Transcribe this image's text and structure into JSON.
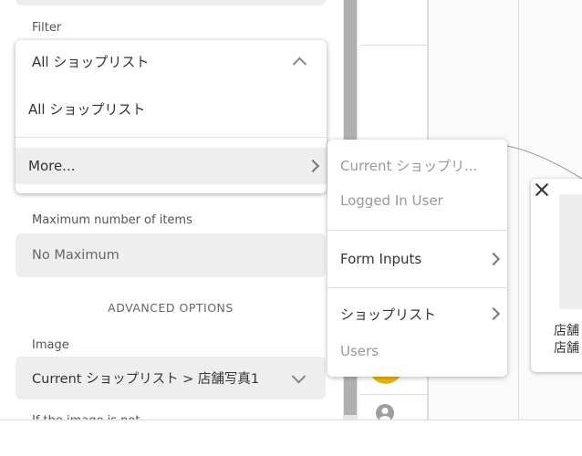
{
  "panel": {
    "filter_label": "Filter",
    "filter_selected": "All ショップリスト",
    "filter_options": [
      "All ショップリスト",
      "More..."
    ],
    "max_items_label": "Maximum number of items",
    "max_items_value": "No Maximum",
    "advanced_options": "ADVANCED OPTIONS",
    "image_label": "Image",
    "image_value": "Current ショップリスト > 店舗写真1",
    "next_label_partial": "If the image is not..."
  },
  "submenu": {
    "items": [
      "Current ショップリ...",
      "Logged In User",
      "Form Inputs",
      "ショップリスト",
      "Users"
    ]
  },
  "card": {
    "text_line1": "店舗",
    "text_line2": "店舗"
  },
  "colors": {
    "accent_yellow": "#f3b400",
    "hover_bg": "#eeeeee"
  }
}
